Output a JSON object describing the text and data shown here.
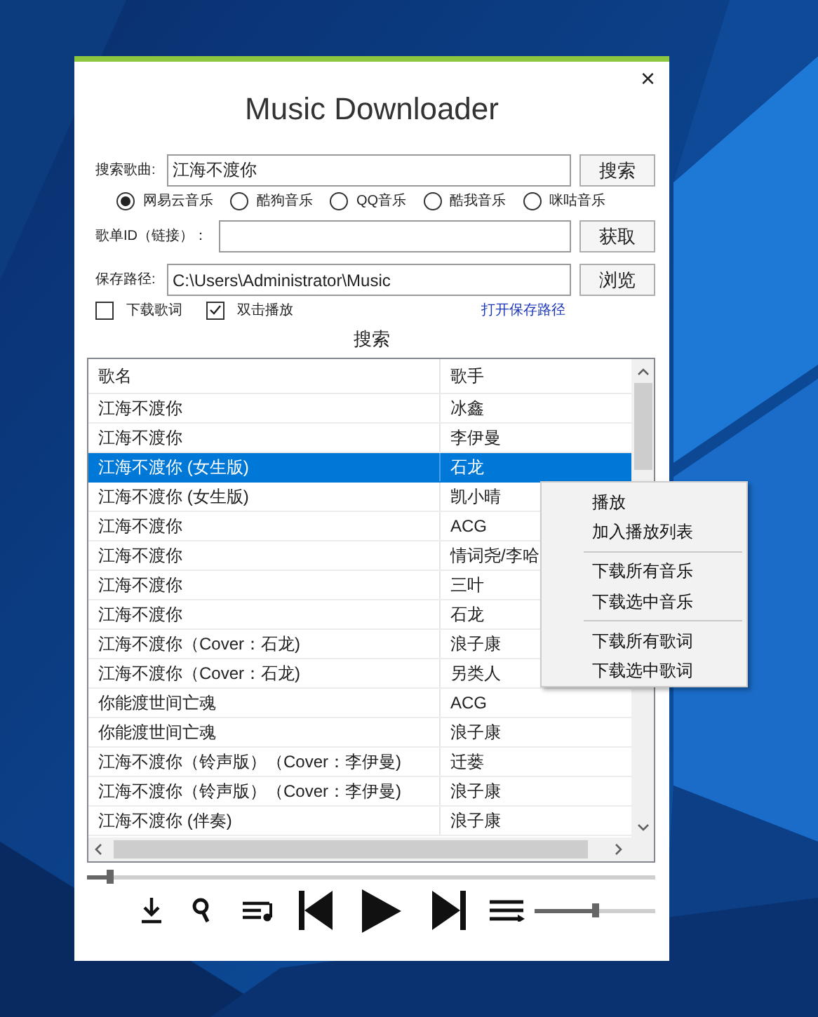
{
  "window": {
    "title": "Music Downloader",
    "close": "×"
  },
  "search": {
    "label": "搜索歌曲:",
    "value": "江海不渡你",
    "button": "搜索"
  },
  "sources": [
    {
      "label": "网易云音乐",
      "selected": true
    },
    {
      "label": "酷狗音乐",
      "selected": false
    },
    {
      "label": "QQ音乐",
      "selected": false
    },
    {
      "label": "酷我音乐",
      "selected": false
    },
    {
      "label": "咪咕音乐",
      "selected": false
    }
  ],
  "playlist": {
    "label": "歌单ID（链接）：",
    "button": "获取"
  },
  "save_path": {
    "label": "保存路径:",
    "value": "C:\\Users\\Administrator\\Music",
    "button": "浏览"
  },
  "options": [
    {
      "label": "下载歌词",
      "checked": false
    },
    {
      "label": "双击播放",
      "checked": true
    }
  ],
  "open_folder_link": "打开保存路径",
  "results_title": "搜索",
  "table": {
    "columns": [
      "歌名",
      "歌手"
    ],
    "rows": [
      {
        "cells": [
          "江海不渡你",
          "冰鑫"
        ],
        "selected": false
      },
      {
        "cells": [
          "江海不渡你",
          "李伊曼"
        ],
        "selected": false
      },
      {
        "cells": [
          "江海不渡你 (女生版)",
          "石龙"
        ],
        "selected": true
      },
      {
        "cells": [
          "江海不渡你 (女生版)",
          "凯小晴"
        ],
        "selected": false
      },
      {
        "cells": [
          "江海不渡你",
          "ACG"
        ],
        "selected": false
      },
      {
        "cells": [
          "江海不渡你",
          "情词尧/李哈"
        ],
        "selected": false
      },
      {
        "cells": [
          "江海不渡你",
          "三叶"
        ],
        "selected": false
      },
      {
        "cells": [
          "江海不渡你",
          "石龙"
        ],
        "selected": false
      },
      {
        "cells": [
          "江海不渡你（Cover：石龙)",
          "浪子康"
        ],
        "selected": false
      },
      {
        "cells": [
          "江海不渡你（Cover：石龙)",
          "另类人"
        ],
        "selected": false
      },
      {
        "cells": [
          "你能渡世间亡魂",
          "ACG"
        ],
        "selected": false
      },
      {
        "cells": [
          "你能渡世间亡魂",
          "浪子康"
        ],
        "selected": false
      },
      {
        "cells": [
          "江海不渡你（铃声版）（Cover：李伊曼)",
          "迁蒌"
        ],
        "selected": false
      },
      {
        "cells": [
          "江海不渡你（铃声版）（Cover：李伊曼)",
          "浪子康"
        ],
        "selected": false
      },
      {
        "cells": [
          "江海不渡你 (伴奏)",
          "浪子康"
        ],
        "selected": false
      }
    ]
  },
  "context_menu": {
    "groups": [
      [
        "播放",
        "加入播放列表"
      ],
      [
        "下载所有音乐",
        "下载选中音乐"
      ],
      [
        "下载所有歌词",
        "下载选中歌词"
      ]
    ]
  },
  "player": {
    "progress": {
      "level": 0.04
    },
    "volume": {
      "level": 0.5
    }
  }
}
